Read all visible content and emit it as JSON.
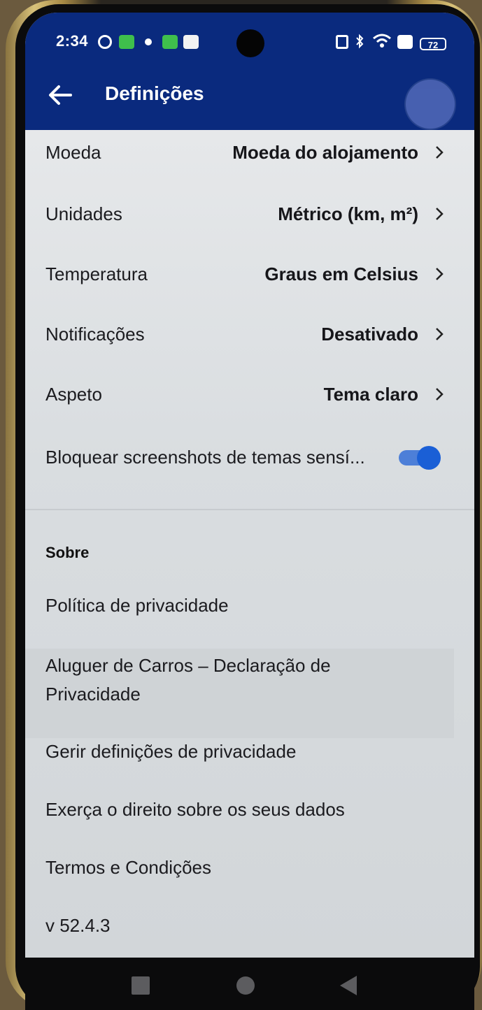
{
  "status_bar": {
    "time": "2:34",
    "battery": "72"
  },
  "app_bar": {
    "title": "Definições",
    "back_icon": "arrow-left-icon"
  },
  "settings": [
    {
      "label": "Moeda",
      "value": "Moeda do alojamento"
    },
    {
      "label": "Unidades",
      "value": "Métrico (km, m²)"
    },
    {
      "label": "Temperatura",
      "value": "Graus em Celsius"
    },
    {
      "label": "Notificações",
      "value": "Desativado"
    },
    {
      "label": "Aspeto",
      "value": "Tema claro"
    }
  ],
  "screenshot_toggle": {
    "label": "Bloquear screenshots de temas sensí...",
    "on": true
  },
  "about": {
    "heading": "Sobre",
    "links": [
      "Política de privacidade",
      "Aluguer de Carros – Declaração de",
      "Privacidade",
      "Gerir definições de privacidade",
      "Exerça o direito sobre os seus dados",
      "Termos e Condições"
    ],
    "version": "v 52.4.3"
  },
  "colors": {
    "app_bar": "#0a2a7e",
    "toggle_on": "#1a5fd6"
  }
}
